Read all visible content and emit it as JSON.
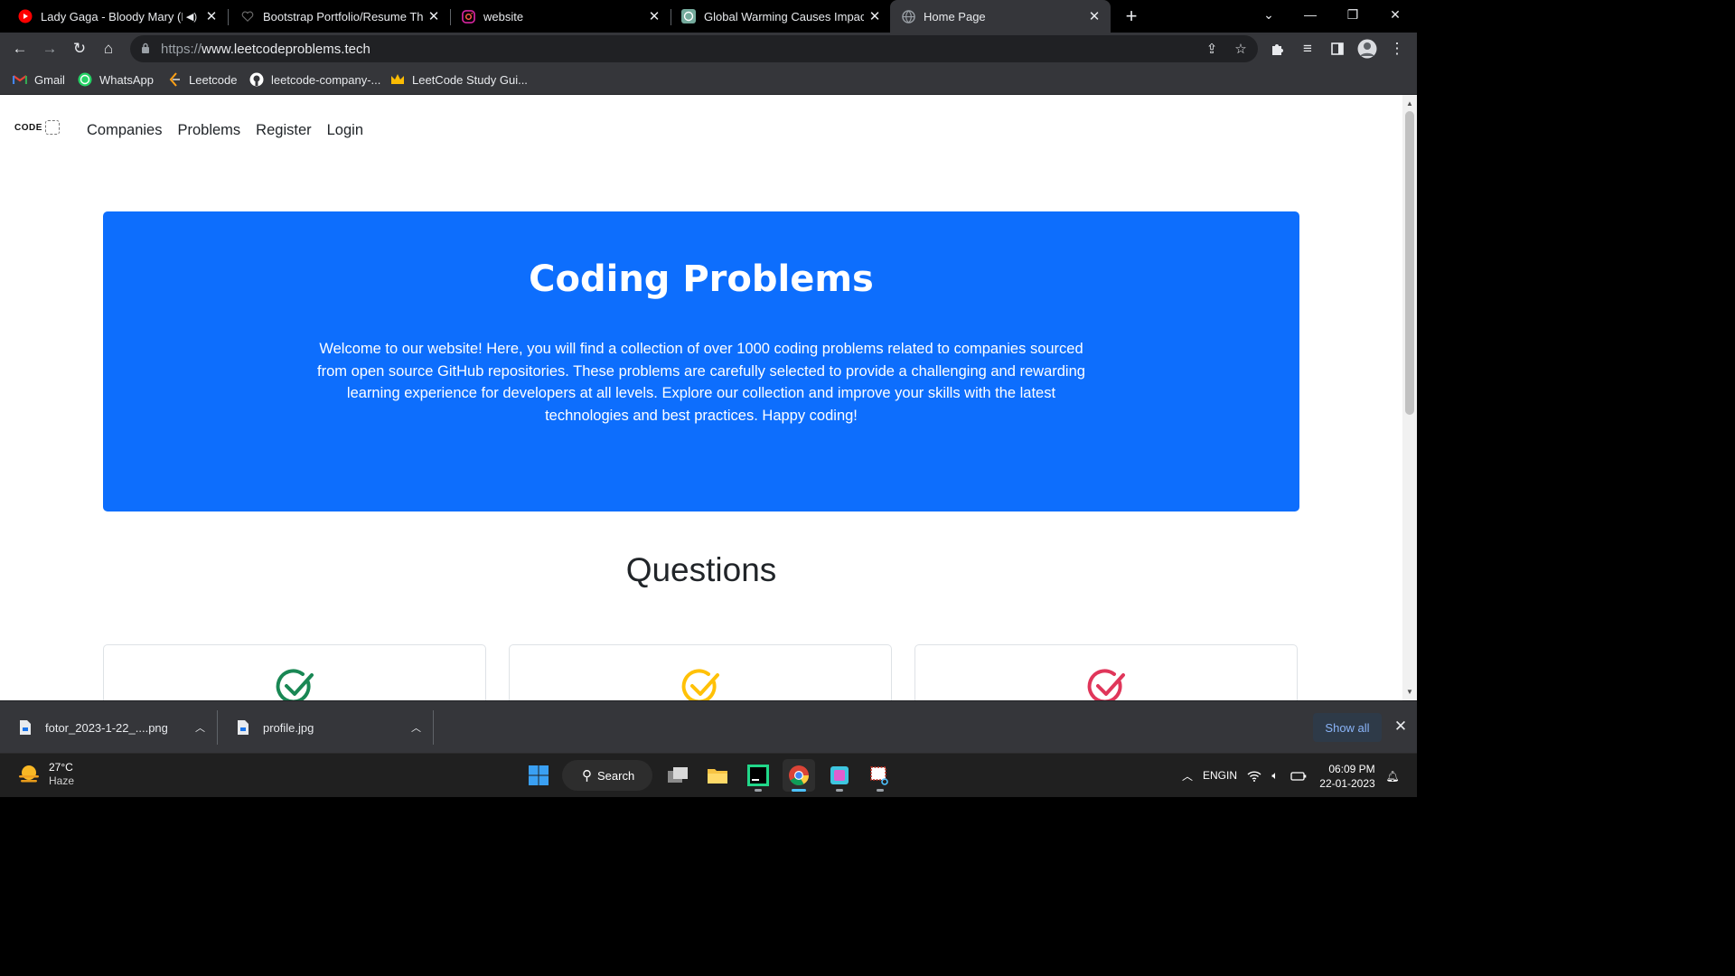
{
  "browser": {
    "tabs": [
      {
        "title": "Lady Gaga - Bloody Mary (Ly",
        "favicon": "youtube-icon",
        "audio": true,
        "active": false
      },
      {
        "title": "Bootstrap Portfolio/Resume Them",
        "favicon": "heart-icon",
        "active": false
      },
      {
        "title": "website",
        "favicon": "instagram-icon",
        "active": false
      },
      {
        "title": "Global Warming Causes Impact",
        "favicon": "chatgpt-icon",
        "active": false
      },
      {
        "title": "Home Page",
        "favicon": "globe-icon",
        "active": true
      }
    ],
    "url_scheme": "https://",
    "url_host": "www.leetcodeproblems.tech",
    "bookmarks": [
      {
        "label": "Gmail",
        "icon": "gmail-icon"
      },
      {
        "label": "WhatsApp",
        "icon": "whatsapp-icon"
      },
      {
        "label": "Leetcode",
        "icon": "leetcode-icon"
      },
      {
        "label": "leetcode-company-...",
        "icon": "github-icon"
      },
      {
        "label": "LeetCode Study Gui...",
        "icon": "crown-icon"
      }
    ]
  },
  "page": {
    "logo_text": "CODE",
    "nav": [
      "Companies",
      "Problems",
      "Register",
      "Login"
    ],
    "hero": {
      "title": "Coding Problems",
      "text": "Welcome to our website! Here, you will find a collection of over 1000 coding problems related to companies sourced from open source GitHub repositories. These problems are carefully selected to provide a challenging and rewarding learning experience for developers at all levels. Explore our collection and improve your skills with the latest technologies and best practices. Happy coding!"
    },
    "questions_heading": "Questions",
    "cards": [
      {
        "icon": "check-circle-icon",
        "color": "#198754"
      },
      {
        "icon": "check-circle-icon",
        "color": "#ffc107"
      },
      {
        "icon": "check-circle-icon",
        "color": "#dc3545"
      }
    ],
    "accent_color": "#0d6efd"
  },
  "downloads": {
    "items": [
      {
        "name": "fotor_2023-1-22_....png"
      },
      {
        "name": "profile.jpg"
      }
    ],
    "show_all": "Show all"
  },
  "taskbar": {
    "temperature": "27°C",
    "condition": "Haze",
    "search": "Search",
    "lang_top": "ENG",
    "lang_bottom": "IN",
    "time": "06:09 PM",
    "date": "22-01-2023"
  }
}
